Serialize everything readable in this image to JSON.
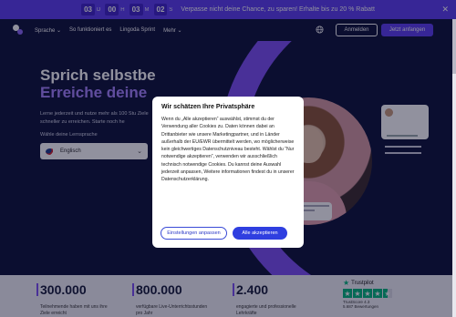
{
  "promo": {
    "days": "03",
    "days_unit": "D",
    "hours": "00",
    "hours_unit": "H",
    "minutes": "03",
    "minutes_unit": "M",
    "seconds": "02",
    "seconds_unit": "S",
    "message": "Verpasse nicht deine Chance, zu sparen! Erhalte bis zu 20 % Rabatt",
    "close": "✕"
  },
  "nav": {
    "items": [
      "Sprache ⌄",
      "So funktioniert es",
      "Lingoda Sprint",
      "Mehr ⌄"
    ],
    "login": "Anmelden",
    "start": "Jetzt anfangen"
  },
  "hero": {
    "headline_1": "Sprich selbstbe",
    "headline_2": "Erreiche deine",
    "subtitle": "Lerne jederzeit und nutze mehr als 100 Stu Ziele schneller zu erreichen. Starte noch he",
    "choose_label": "Wähle deine Lernsprache",
    "language": "Englisch",
    "chevron": "⌄"
  },
  "modal": {
    "title": "Wir schätzen Ihre Privatsphäre",
    "body": "Wenn du „Alle akzeptieren“ auswählst, stimmst du der Verwendung aller Cookies zu. Daten können dabei an Drittanbieter wie unsere Marketingpartner, und in Länder außerhalb der EU/EWR übermittelt werden, wo möglicherweise kein gleichwertiges Datenschutzniveau besteht. Wählst du “Nur notwendige akzeptieren”, verwenden wir ausschließlich technisch notwendige Cookies. Du kannst deine Auswahl jederzeit anpassen, Weitere informationen findest du in unserer Datenschutzerklärung.",
    "settings_button": "Einstellungen anpassen",
    "accept_button": "Alle akzeptieren"
  },
  "stats": [
    {
      "value": "300.000",
      "label": "Teilnehmende haben mit uns ihre Ziele erreicht"
    },
    {
      "value": "800.000",
      "label": "verfügbare Live-Unterrichtsstunden pro Jahr"
    },
    {
      "value": "2.400",
      "label": "engagierte und professionelle Lehrkräfte"
    }
  ],
  "trustpilot": {
    "label": "Trustpilot",
    "score": "TrustScore 4.3",
    "reviews": "5.687 Bewertungen"
  },
  "colors": {
    "brand_purple": "#7d4ff5",
    "promo_bg": "#5b3df0",
    "dark_bg": "#0c1137",
    "accept_blue": "#2f3fe0",
    "trustpilot_green": "#00b67a"
  }
}
